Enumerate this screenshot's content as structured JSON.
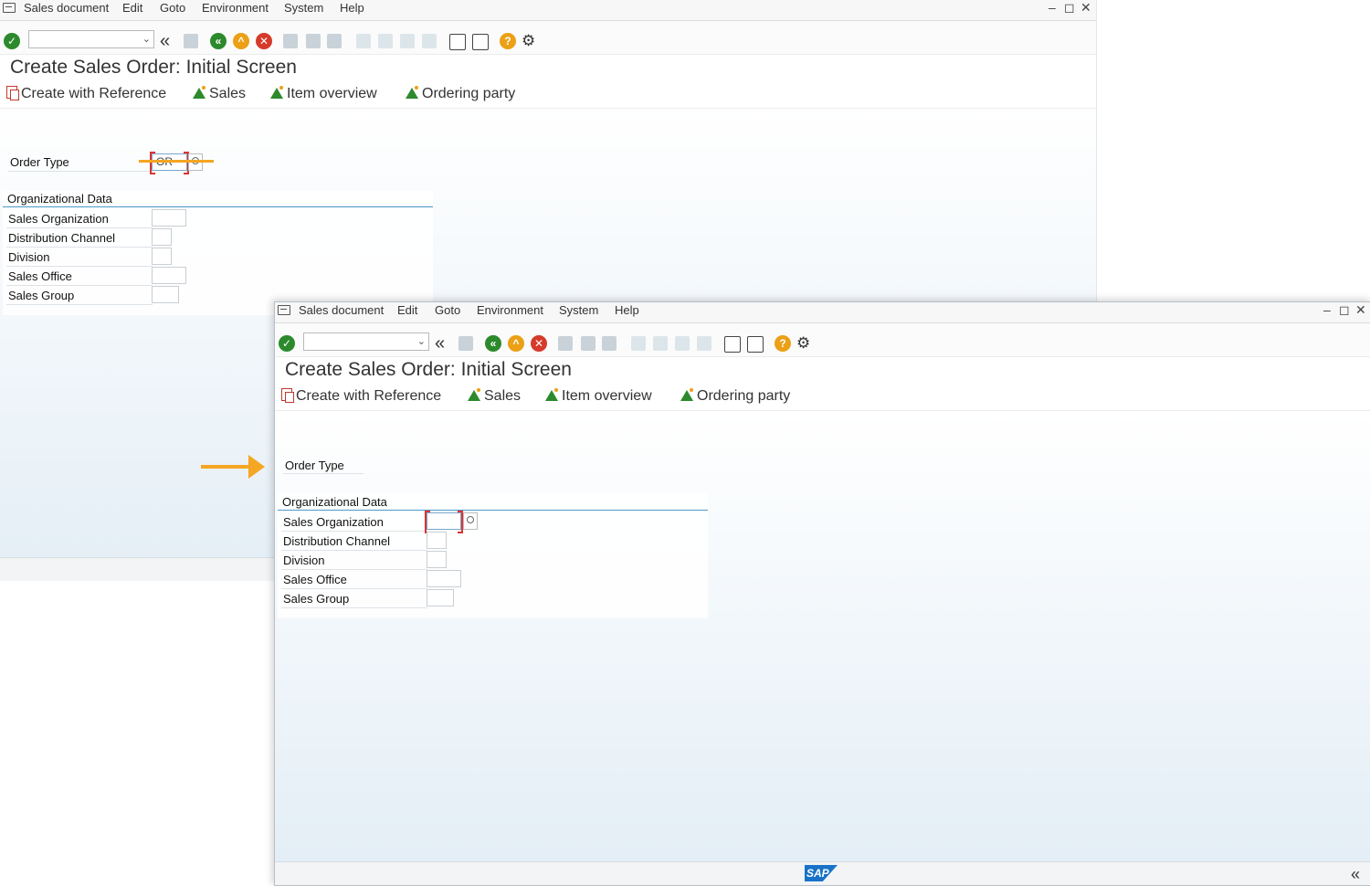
{
  "menu": {
    "items": [
      "Sales document",
      "Edit",
      "Goto",
      "Environment",
      "System",
      "Help"
    ],
    "window_controls": [
      "–",
      "◻",
      "✕"
    ]
  },
  "toolbar": {
    "command_field_value": "",
    "icons": [
      "enter-icon",
      "back-icon",
      "save-icon",
      "back-green-icon",
      "exit-icon",
      "cancel-icon",
      "print-icon",
      "find-icon",
      "find-next-icon",
      "first-page-icon",
      "previous-page-icon",
      "next-page-icon",
      "last-page-icon",
      "create-session-icon",
      "shortcut-icon",
      "help-icon",
      "customize-icon"
    ]
  },
  "screen": {
    "title": "Create Sales Order: Initial Screen",
    "app_toolbar": [
      "Create with Reference",
      "Sales",
      "Item overview",
      "Ordering party"
    ]
  },
  "form": {
    "order_type_label": "Order Type",
    "order_type_value_before": "OR",
    "order_type_value_after": "",
    "group_title": "Organizational Data",
    "fields": [
      "Sales Organization",
      "Distribution Channel",
      "Division",
      "Sales Office",
      "Sales Group"
    ]
  },
  "footer": {
    "logo_text": "SAP",
    "collapse_glyph": "«"
  },
  "colors": {
    "accent": "#f5a623",
    "ok_green": "#2c8a2c",
    "cancel_red": "#d63a2a",
    "group_line": "#4b98c4"
  }
}
